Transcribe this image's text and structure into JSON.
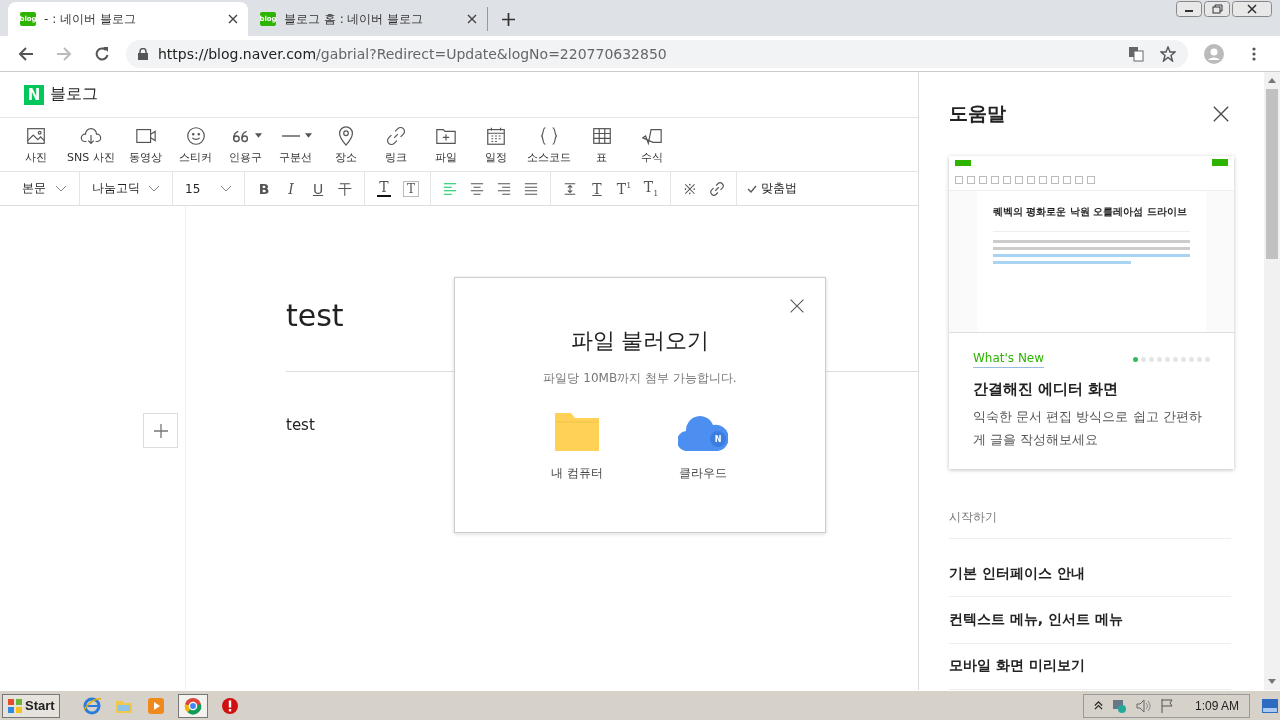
{
  "browser": {
    "tabs": [
      {
        "title": "- : 네이버 블로그",
        "favicon": "blog",
        "selected": true
      },
      {
        "title": "블로그 홈 : 네이버 블로그",
        "favicon": "blog",
        "selected": false
      }
    ],
    "url_host": "https://blog.naver.com",
    "url_path": "/gabrial?Redirect=Update&logNo=220770632850"
  },
  "editor": {
    "logo_mark": "N",
    "logo_text": "블로그",
    "tools": [
      {
        "kind": "image",
        "label": "사진"
      },
      {
        "kind": "cloud",
        "label": "SNS 사진"
      },
      {
        "kind": "video",
        "label": "동영상"
      },
      {
        "kind": "smile",
        "label": "스티커"
      },
      {
        "kind": "quote",
        "label": "인용구"
      },
      {
        "kind": "line",
        "label": "구분선"
      },
      {
        "kind": "pin",
        "label": "장소"
      },
      {
        "kind": "link",
        "label": "링크"
      },
      {
        "kind": "file",
        "label": "파일"
      },
      {
        "kind": "calendar",
        "label": "일정"
      },
      {
        "kind": "code",
        "label": "소스코드"
      },
      {
        "kind": "table",
        "label": "표"
      },
      {
        "kind": "formula",
        "label": "수식"
      }
    ],
    "dropdowns": [
      {
        "value": "본문"
      },
      {
        "value": "나눔고딕"
      },
      {
        "value": "15"
      }
    ],
    "format_groups": [
      [
        {
          "kind": "bold",
          "glyph": "B",
          "selected": false
        },
        {
          "kind": "italic",
          "glyph": "I",
          "selected": false
        },
        {
          "kind": "underline",
          "glyph": "U",
          "selected": false
        },
        {
          "kind": "strike",
          "glyph": "干",
          "selected": false
        }
      ],
      [
        {
          "kind": "color",
          "glyph": "T",
          "selected": false
        },
        {
          "kind": "bg",
          "glyph": "T",
          "selected": false
        }
      ],
      [
        {
          "kind": "align-left",
          "selected": true
        },
        {
          "kind": "align-center",
          "selected": false
        },
        {
          "kind": "align-right",
          "selected": false
        },
        {
          "kind": "justify",
          "selected": false
        }
      ],
      [
        {
          "kind": "line-height",
          "selected": false
        },
        {
          "kind": "spacing",
          "glyph": "T",
          "selected": false
        },
        {
          "kind": "sup",
          "glyph": "T",
          "sub": "1",
          "selected": false
        },
        {
          "kind": "subs",
          "glyph": "T",
          "sub": "1",
          "selected": false
        }
      ],
      [
        {
          "kind": "special",
          "glyph": "※",
          "selected": false
        },
        {
          "kind": "link",
          "selected": false
        }
      ]
    ],
    "spellcheck": "맞춤법",
    "title": "test",
    "body": "test"
  },
  "dialog": {
    "title": "파일 불러오기",
    "subtitle": "파일당 10MB까지 첨부 가능합니다.",
    "options": [
      {
        "kind": "folder",
        "label": "내 컴퓨터"
      },
      {
        "kind": "cloud",
        "label": "클라우드",
        "badge": "N"
      }
    ]
  },
  "help": {
    "title": "도움말",
    "card": {
      "preview_title": "퀘벡의 평화로운 낙원 오를레아섬 드라이브",
      "eyebrow": "What's New",
      "slides": [
        {
          "selected": true
        },
        {
          "selected": false
        },
        {
          "selected": false
        },
        {
          "selected": false
        },
        {
          "selected": false
        },
        {
          "selected": false
        },
        {
          "selected": false
        },
        {
          "selected": false
        },
        {
          "selected": false
        },
        {
          "selected": false
        }
      ],
      "heading": "간결해진 에디터 화면",
      "text": "익숙한 문서 편집 방식으로 쉽고 간편하게 글을 작성해보세요"
    },
    "section": "시작하기",
    "items": [
      "기본 인터페이스 안내",
      "컨텍스트 메뉴, 인서트 메뉴",
      "모바일 화면 미리보기"
    ]
  },
  "taskbar": {
    "start": "Start",
    "clock": "1:09 AM"
  }
}
